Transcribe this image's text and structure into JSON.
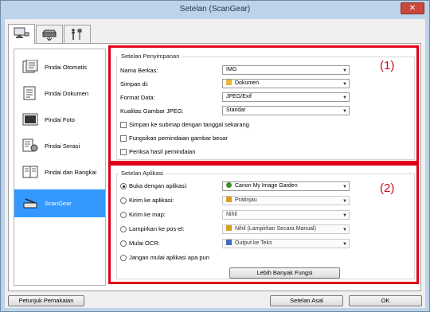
{
  "window": {
    "title": "Setelan (ScanGear)"
  },
  "tabs": [
    {
      "icon": "scan-computer-icon"
    },
    {
      "icon": "scanner-icon"
    },
    {
      "icon": "tools-icon"
    }
  ],
  "nav": [
    {
      "label": "Pindai Otomatis",
      "icon": "auto-scan-icon"
    },
    {
      "label": "Pindai Dokumen",
      "icon": "document-scan-icon"
    },
    {
      "label": "Pindai Foto",
      "icon": "photo-scan-icon"
    },
    {
      "label": "Pindai Serasi",
      "icon": "custom-scan-icon"
    },
    {
      "label": "Pindai dan Rangkai",
      "icon": "stitch-scan-icon"
    },
    {
      "label": "ScanGear",
      "icon": "scangear-icon",
      "selected": true
    }
  ],
  "save": {
    "title": "Setelan Penyimpanan",
    "filename_label": "Nama Berkas:",
    "filename_value": "IMG",
    "savein_label": "Simpan di:",
    "savein_value": "Dokumen",
    "format_label": "Format Data:",
    "format_value": "JPEG/Exif",
    "quality_label": "Kualitas Gambar JPEG:",
    "quality_value": "Standar",
    "cb1": "Simpan ke submap dengan tanggal sekarang",
    "cb2": "Fungsikan pemindaian gambar besar",
    "cb3": "Periksa hasil pemindaian",
    "marker": "(1)"
  },
  "app": {
    "title": "Setelan Aplikasi",
    "r1_label": "Buka dengan aplikasi:",
    "r1_value": "Canon My Image Garden",
    "r2_label": "Kirim ke aplikasi:",
    "r2_value": "Pratinjau",
    "r3_label": "Kirim ke map:",
    "r3_value": "Nihil",
    "r4_label": "Lampirkan ke pos-el:",
    "r4_value": "Nihil (Lampirkan Secara Manual)",
    "r5_label": "Mulai OCR:",
    "r5_value": "Output ke Teks",
    "r6_label": "Jangan mulai aplikasi apa pun",
    "more_button": "Lebih Banyak Fungsi",
    "marker": "(2)"
  },
  "footer": {
    "help": "Petunjuk Pemakaian",
    "defaults": "Setelan Asal",
    "ok": "OK"
  },
  "colors": {
    "highlight": "#3399ff",
    "marker_red": "#e0001a"
  }
}
